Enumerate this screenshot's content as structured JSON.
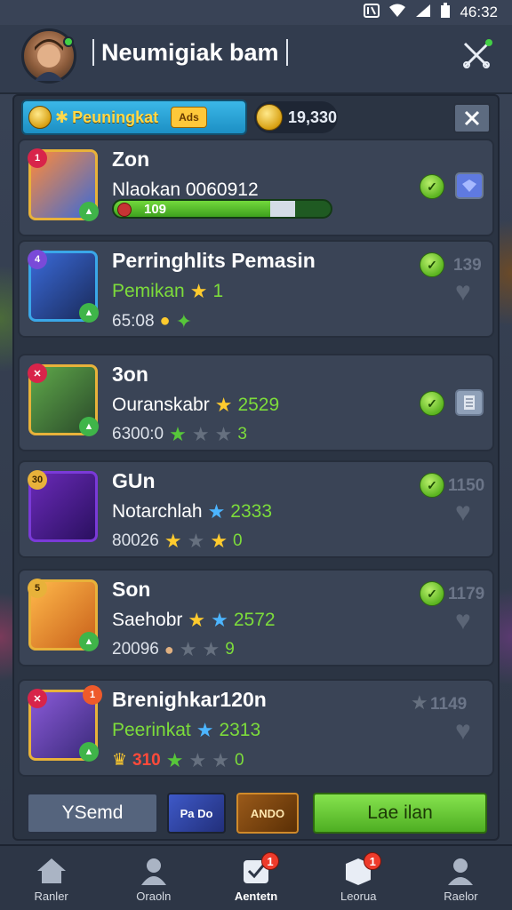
{
  "status_bar": {
    "time": "46:32"
  },
  "header": {
    "title": "Neumigiak bam"
  },
  "currency": {
    "label": "Peuningkat",
    "chip": "Ads",
    "gold_value": "19,330"
  },
  "rows": [
    {
      "title": "Zon",
      "subtitle": "Nlaokan 0060912",
      "progress_label": "109",
      "progress_fill": 0.72
    },
    {
      "title": "Perringhlits Pemasin",
      "subtitle": "Pemikan",
      "subtitle_num": "1",
      "meta": "65:08",
      "count": "139"
    },
    {
      "title": "3on",
      "subtitle": "Ouranskabr",
      "subtitle_num": "2529",
      "meta": "6300:0",
      "meta_num": "3"
    },
    {
      "title": "GUn",
      "subtitle": "Notarchlah",
      "subtitle_num": "2333",
      "meta": "80026",
      "meta_num": "0",
      "count": "1150"
    },
    {
      "title": "Son",
      "subtitle": "Saehobr",
      "subtitle_num": "2572",
      "meta": "20096",
      "meta_num": "9",
      "count": "1179"
    },
    {
      "title": "Brenighkar120n",
      "subtitle": "Peerinkat",
      "subtitle_num": "2313",
      "meta": "310",
      "meta_num": "0",
      "count": "1149"
    }
  ],
  "footer": {
    "send_label": "YSemd",
    "mini_a": "Pa Do",
    "mini_b": "ANDO",
    "primary_label": "Lae ilan"
  },
  "nav": [
    {
      "label": "Ranler",
      "icon": "home-icon"
    },
    {
      "label": "Oraoln",
      "icon": "profile-icon"
    },
    {
      "label": "Aentetn",
      "icon": "inbox-icon",
      "badge": "1"
    },
    {
      "label": "Leorua",
      "icon": "box-icon",
      "badge": "1"
    },
    {
      "label": "Raelor",
      "icon": "user-icon"
    }
  ]
}
